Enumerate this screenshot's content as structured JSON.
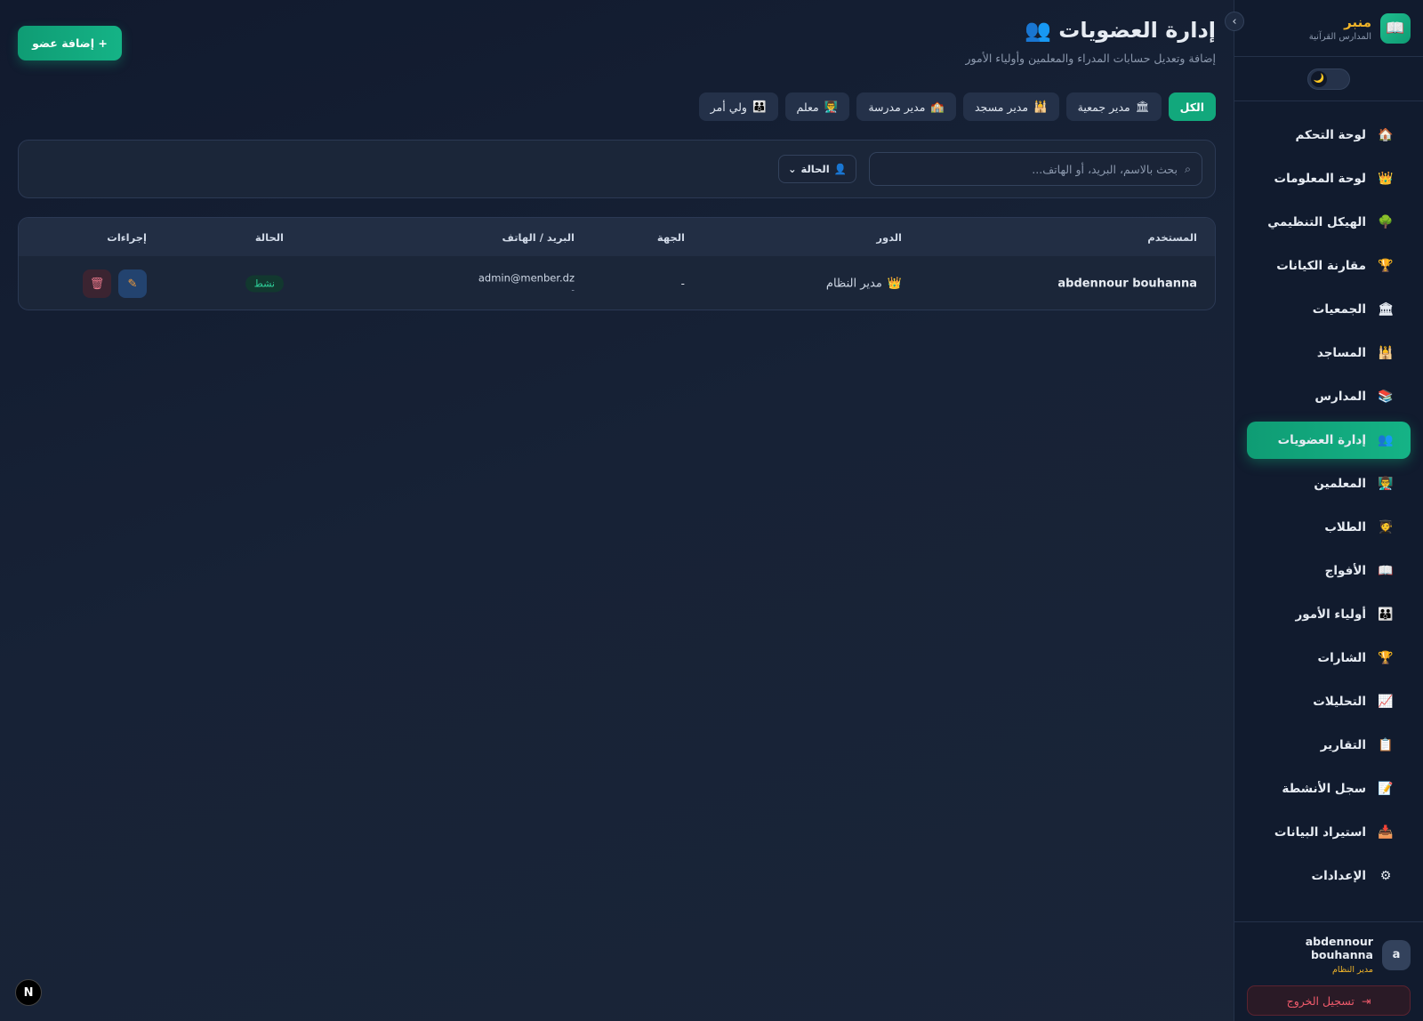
{
  "brand": {
    "name": "منبر",
    "subtitle": "المدارس القرآنية",
    "logo_icon": "📖"
  },
  "theme_toggle": {
    "icon": "🌙"
  },
  "sidebar": {
    "items": [
      {
        "label": "لوحة التحكم",
        "icon": "🏠"
      },
      {
        "label": "لوحة المعلومات",
        "icon": "👑"
      },
      {
        "label": "الهيكل التنظيمي",
        "icon": "🌳"
      },
      {
        "label": "مقارنة الكيانات",
        "icon": "🏆"
      },
      {
        "label": "الجمعيات",
        "icon": "🏛"
      },
      {
        "label": "المساجد",
        "icon": "🕌"
      },
      {
        "label": "المدارس",
        "icon": "📚"
      },
      {
        "label": "إدارة العضويات",
        "icon": "👥",
        "active": true
      },
      {
        "label": "المعلمين",
        "icon": "👨‍🏫"
      },
      {
        "label": "الطلاب",
        "icon": "🧑‍🎓"
      },
      {
        "label": "الأفواج",
        "icon": "📖"
      },
      {
        "label": "أولياء الأمور",
        "icon": "👪"
      },
      {
        "label": "الشارات",
        "icon": "🏆"
      },
      {
        "label": "التحليلات",
        "icon": "📈"
      },
      {
        "label": "التقارير",
        "icon": "📋"
      },
      {
        "label": "سجل الأنشطة",
        "icon": "📝"
      },
      {
        "label": "استيراد البيانات",
        "icon": "📥"
      },
      {
        "label": "الإعدادات",
        "icon": "⚙"
      }
    ]
  },
  "user": {
    "initial": "a",
    "name": "abdennour bouhanna",
    "role": "مدير النظام"
  },
  "logout": {
    "label": "تسجيل الخروج"
  },
  "page": {
    "title": "إدارة العضويات",
    "title_icon": "👥",
    "subtitle": "إضافة وتعديل حسابات المدراء والمعلمين وأولياء الأمور",
    "add_button": "+ إضافة عضو"
  },
  "tabs": [
    {
      "label": "الكل",
      "icon": "",
      "active": true
    },
    {
      "label": "مدير جمعية",
      "icon": "🏛"
    },
    {
      "label": "مدير مسجد",
      "icon": "🕌"
    },
    {
      "label": "مدير مدرسة",
      "icon": "🏫"
    },
    {
      "label": "معلم",
      "icon": "👨‍🏫"
    },
    {
      "label": "ولي أمر",
      "icon": "👪"
    }
  ],
  "filters": {
    "search_placeholder": "بحث بالاسم، البريد، أو الهاتف...",
    "status_label": "الحالة"
  },
  "table": {
    "headers": {
      "user": "المستخدم",
      "role": "الدور",
      "entity": "الجهة",
      "contact": "البريد / الهاتف",
      "status": "الحالة",
      "actions": "إجراءات"
    },
    "rows": [
      {
        "user": "abdennour bouhanna",
        "role": "مدير النظام",
        "role_icon": "👑",
        "entity": "-",
        "email": "admin@menber.dz",
        "phone": "-",
        "status": "نشط"
      }
    ]
  },
  "dev_badge": "N"
}
